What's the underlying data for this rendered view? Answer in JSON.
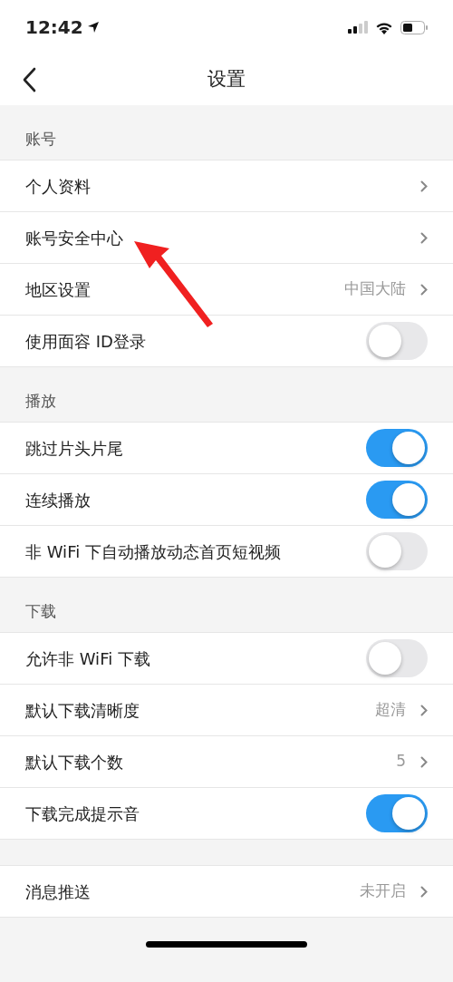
{
  "status_bar": {
    "time": "12:42"
  },
  "nav": {
    "title": "设置"
  },
  "sections": [
    {
      "title": "账号",
      "rows": [
        {
          "kind": "link",
          "label": "个人资料"
        },
        {
          "kind": "link",
          "label": "账号安全中心"
        },
        {
          "kind": "link",
          "label": "地区设置",
          "value": "中国大陆"
        },
        {
          "kind": "toggle",
          "label": "使用面容 ID登录",
          "on": false
        }
      ]
    },
    {
      "title": "播放",
      "rows": [
        {
          "kind": "toggle",
          "label": "跳过片头片尾",
          "on": true
        },
        {
          "kind": "toggle",
          "label": "连续播放",
          "on": true
        },
        {
          "kind": "toggle",
          "label": "非 WiFi 下自动播放动态首页短视频",
          "on": false
        }
      ]
    },
    {
      "title": "下载",
      "rows": [
        {
          "kind": "toggle",
          "label": "允许非 WiFi 下载",
          "on": false
        },
        {
          "kind": "link",
          "label": "默认下载清晰度",
          "value": "超清"
        },
        {
          "kind": "link",
          "label": "默认下载个数",
          "value": "5"
        },
        {
          "kind": "toggle",
          "label": "下载完成提示音",
          "on": true
        }
      ]
    },
    {
      "rows": [
        {
          "kind": "link",
          "label": "消息推送",
          "value": "未开启"
        }
      ]
    }
  ]
}
